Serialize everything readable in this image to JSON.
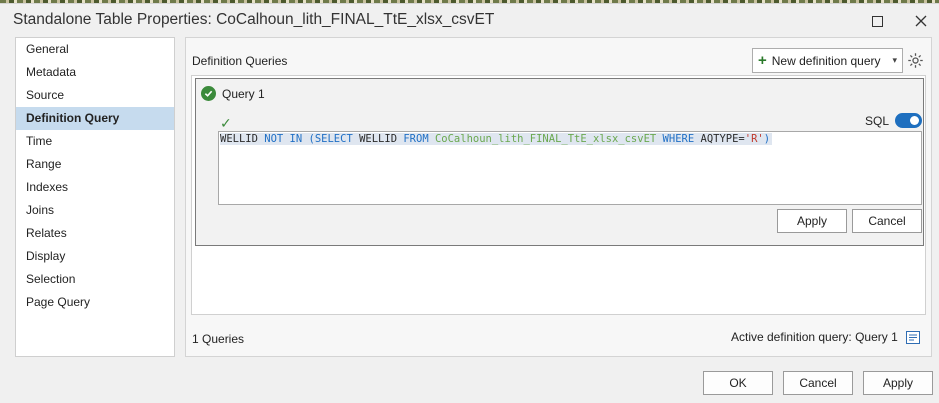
{
  "window": {
    "title": "Standalone Table Properties: CoCalhoun_lith_FINAL_TtE_xlsx_csvET"
  },
  "nav": {
    "items": [
      {
        "label": "General",
        "active": false
      },
      {
        "label": "Metadata",
        "active": false
      },
      {
        "label": "Source",
        "active": false
      },
      {
        "label": "Definition Query",
        "active": true
      },
      {
        "label": "Time",
        "active": false
      },
      {
        "label": "Range",
        "active": false
      },
      {
        "label": "Indexes",
        "active": false
      },
      {
        "label": "Joins",
        "active": false
      },
      {
        "label": "Relates",
        "active": false
      },
      {
        "label": "Display",
        "active": false
      },
      {
        "label": "Selection",
        "active": false
      },
      {
        "label": "Page Query",
        "active": false
      }
    ]
  },
  "pane": {
    "title": "Definition Queries",
    "new_query_label": "New definition query",
    "query": {
      "name": "Query 1",
      "sql_label": "SQL",
      "sql_enabled": true,
      "sql_tokens": [
        {
          "text": "WELLID",
          "kind": "fld"
        },
        {
          "text": " NOT IN (SELECT ",
          "kind": "kw"
        },
        {
          "text": "WELLID",
          "kind": "fld"
        },
        {
          "text": " FROM ",
          "kind": "kw"
        },
        {
          "text": "CoCalhoun_lith_FINAL_TtE_xlsx_csvET",
          "kind": "tbl"
        },
        {
          "text": " WHERE ",
          "kind": "kw"
        },
        {
          "text": "AQTYPE=",
          "kind": "fld"
        },
        {
          "text": "'R'",
          "kind": "str"
        },
        {
          "text": ")",
          "kind": "kw"
        }
      ],
      "apply_label": "Apply",
      "cancel_label": "Cancel"
    },
    "footer": {
      "count_text": "1 Queries",
      "active_text": "Active definition query: Query 1"
    }
  },
  "dialog_buttons": {
    "ok": "OK",
    "cancel": "Cancel",
    "apply": "Apply"
  },
  "colors": {
    "accent": "#1e6fbf",
    "success": "#3b8a3b",
    "nav_active": "#c6dbee"
  }
}
